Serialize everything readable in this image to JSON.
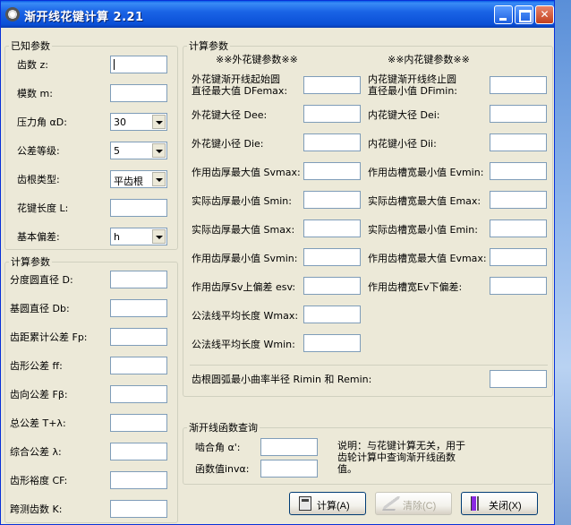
{
  "window": {
    "title": "渐开线花键计算  2.21"
  },
  "known": {
    "legend": "已知参数",
    "fields": [
      {
        "label": "齿数 z:",
        "value": ""
      },
      {
        "label": "模数 m:",
        "value": ""
      },
      {
        "label": "压力角 αD:",
        "value": "30"
      },
      {
        "label": "公差等级:",
        "value": "5"
      },
      {
        "label": "齿根类型:",
        "value": "平齿根"
      },
      {
        "label": "花键长度 L:",
        "value": ""
      },
      {
        "label": "基本偏差:",
        "value": "h"
      }
    ]
  },
  "calc_left": {
    "legend": "计算参数",
    "fields": [
      {
        "label": "分度圆直径 D:",
        "value": ""
      },
      {
        "label": "基圆直径 Db:",
        "value": ""
      },
      {
        "label": "齿距累计公差 Fp:",
        "value": ""
      },
      {
        "label": "齿形公差 ff:",
        "value": ""
      },
      {
        "label": "齿向公差 Fβ:",
        "value": ""
      },
      {
        "label": "总公差 T+λ:",
        "value": ""
      },
      {
        "label": "综合公差 λ:",
        "value": ""
      },
      {
        "label": "齿形裕度 CF:",
        "value": ""
      },
      {
        "label": "跨测齿数 K:",
        "value": ""
      }
    ]
  },
  "calc_main": {
    "legend": "计算参数",
    "external_header": "※※外花键参数※※",
    "internal_header": "※※内花键参数※※",
    "external": [
      {
        "label": "外花键渐开线起始圆",
        "label2": "直径最大值 DFemax:",
        "value": ""
      },
      {
        "label": "外花键大径 Dee:",
        "value": ""
      },
      {
        "label": "外花键小径 Die:",
        "value": ""
      },
      {
        "label": "作用齿厚最大值 Svmax:",
        "value": ""
      },
      {
        "label": "实际齿厚最小值 Smin:",
        "value": ""
      },
      {
        "label": "实际齿厚最大值 Smax:",
        "value": ""
      },
      {
        "label": "作用齿厚最小值 Svmin:",
        "value": ""
      },
      {
        "label": "作用齿厚Sv上偏差 esv:",
        "value": ""
      },
      {
        "label": "公法线平均长度 Wmax:",
        "value": ""
      },
      {
        "label": "公法线平均长度 Wmin:",
        "value": ""
      }
    ],
    "internal": [
      {
        "label": "内花键渐开线终止圆",
        "label2": "直径最小值 DFimin:",
        "value": ""
      },
      {
        "label": "内花键大径 Dei:",
        "value": ""
      },
      {
        "label": "内花键小径 Dii:",
        "value": ""
      },
      {
        "label": "作用齿槽宽最小值 Evmin:",
        "value": ""
      },
      {
        "label": "实际齿槽宽最大值 Emax:",
        "value": ""
      },
      {
        "label": "实际齿槽宽最小值 Emin:",
        "value": ""
      },
      {
        "label": "作用齿槽宽最大值 Evmax:",
        "value": ""
      },
      {
        "label": "作用齿槽宽Ev下偏差:",
        "value": ""
      }
    ],
    "fillet": {
      "label": "齿根圆弧最小曲率半径 Rimin 和 Remin:",
      "value": ""
    }
  },
  "involute": {
    "legend": "渐开线函数查询",
    "angle_label": "啮合角 α':",
    "angle_value": "",
    "inv_label": "函数值invα:",
    "inv_value": "",
    "note": "说明：与花键计算无关，用于齿轮计算中查询渐开线函数值。"
  },
  "buttons": {
    "calc": "计算(A)",
    "clear": "清除(C)",
    "close": "关闭(X)"
  }
}
